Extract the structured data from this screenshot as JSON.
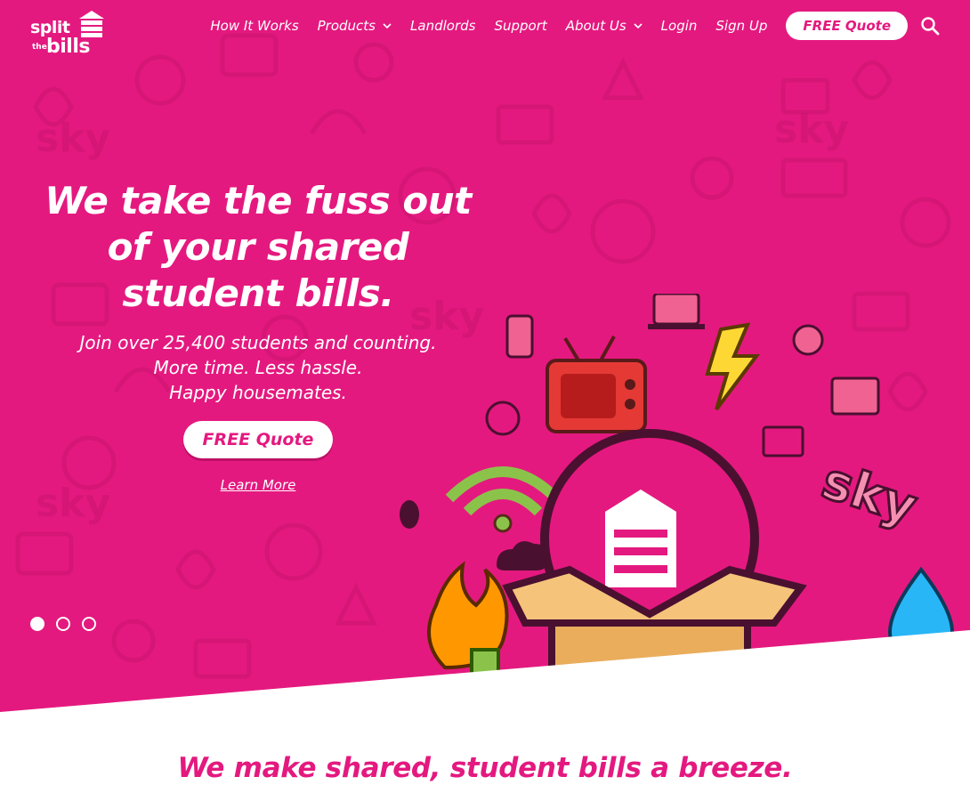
{
  "brand": {
    "logo_split": "split",
    "logo_the": "the",
    "logo_bills": "bills",
    "primary_color": "#e4197f",
    "accent_white": "#ffffff"
  },
  "nav": {
    "items": [
      {
        "label": "How It Works",
        "has_dropdown": false
      },
      {
        "label": "Products",
        "has_dropdown": true
      },
      {
        "label": "Landlords",
        "has_dropdown": false
      },
      {
        "label": "Support",
        "has_dropdown": false
      },
      {
        "label": "About Us",
        "has_dropdown": true
      },
      {
        "label": "Login",
        "has_dropdown": false
      },
      {
        "label": "Sign Up",
        "has_dropdown": false
      }
    ],
    "cta_label": "FREE Quote",
    "search_icon": "search-icon"
  },
  "hero": {
    "headline": "We take the fuss out of your shared student bills.",
    "sub_lines": [
      "Join over 25,400 students and counting.",
      "More time. Less hassle.",
      "Happy housemates."
    ],
    "cta_label": "FREE Quote",
    "learn_more": "Learn More",
    "slides_total": 3,
    "active_slide": 1,
    "illustration_sky_text": "sky"
  },
  "section": {
    "tagline": "We make shared, student bills a breeze."
  }
}
